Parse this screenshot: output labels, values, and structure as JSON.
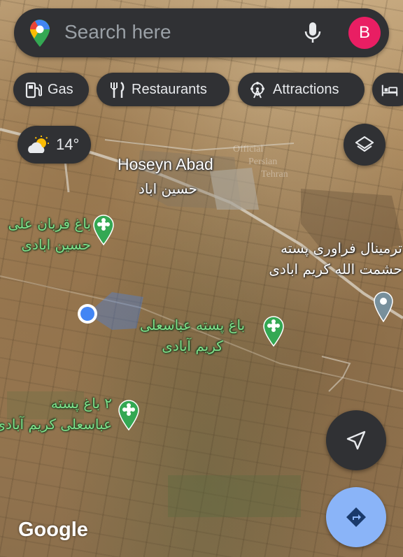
{
  "search": {
    "placeholder": "Search here",
    "avatar_initial": "B"
  },
  "chips": [
    {
      "label": "Gas",
      "icon": "gas-station-icon"
    },
    {
      "label": "Restaurants",
      "icon": "restaurant-icon"
    },
    {
      "label": "Attractions",
      "icon": "ferris-wheel-icon"
    },
    {
      "label": "",
      "icon": "bed-icon"
    }
  ],
  "weather": {
    "temp": "14°",
    "icon": "partly-cloudy-icon"
  },
  "map": {
    "places": [
      {
        "name_en": "Hoseyn Abad",
        "name_fa": "حسين اباد"
      }
    ],
    "pois": [
      {
        "line1": "باغ قربان علی",
        "line2": "حسين ابادی",
        "type": "garden"
      },
      {
        "line1": "باغ پسته عباسعلی",
        "line2": "کريم آبادی",
        "type": "garden"
      },
      {
        "line1": "۲ باغ پسته",
        "line2": "عباسعلی کريم آبادی",
        "type": "garden"
      },
      {
        "line1": "ترمینال فراوری پسته",
        "line2": "حشمت الله کریم ابادی",
        "type": "building"
      }
    ],
    "watermark": [
      "Official",
      "Persian",
      "Tehran"
    ]
  },
  "attribution": "Google",
  "colors": {
    "search_bg": "#303134",
    "avatar": "#e91e63",
    "poi_green": "#34a853",
    "directions": "#8ab4f8",
    "my_location": "#4285f4"
  }
}
